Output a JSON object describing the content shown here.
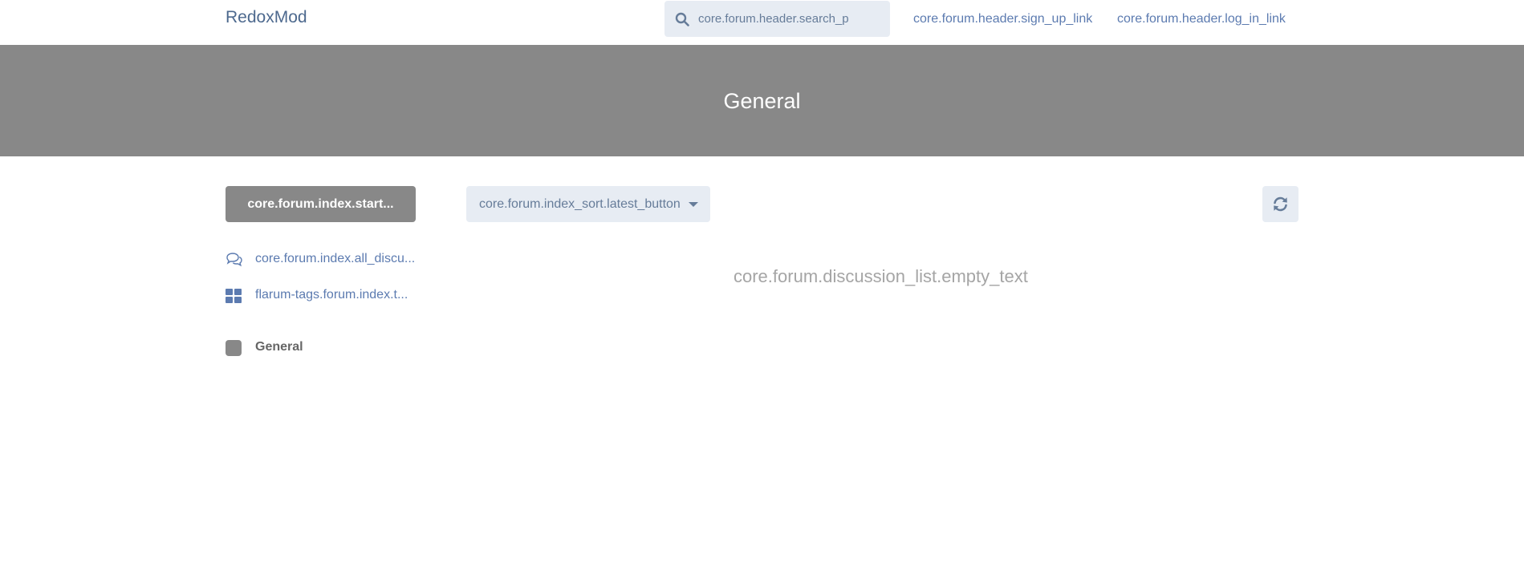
{
  "header": {
    "brand": "RedoxMod",
    "search_placeholder": "core.forum.header.search_p",
    "sign_up": "core.forum.header.sign_up_link",
    "log_in": "core.forum.header.log_in_link"
  },
  "hero": {
    "title": "General",
    "background_color": "#888888"
  },
  "sidebar": {
    "start_button": "core.forum.index.start...",
    "items": [
      {
        "label": "core.forum.index.all_discu...",
        "icon": "comments-icon"
      },
      {
        "label": "flarum-tags.forum.index.t...",
        "icon": "tags-grid-icon"
      }
    ],
    "tags": [
      {
        "label": "General",
        "color": "#888888"
      }
    ]
  },
  "toolbar": {
    "sort_label": "core.forum.index_sort.latest_button",
    "refresh_icon": "refresh-icon"
  },
  "discussion_list": {
    "empty_text": "core.forum.discussion_list.empty_text"
  },
  "colors": {
    "link": "#5c7bb0",
    "button_bg": "#e7ecf3",
    "muted_text": "#a5a5a5"
  }
}
